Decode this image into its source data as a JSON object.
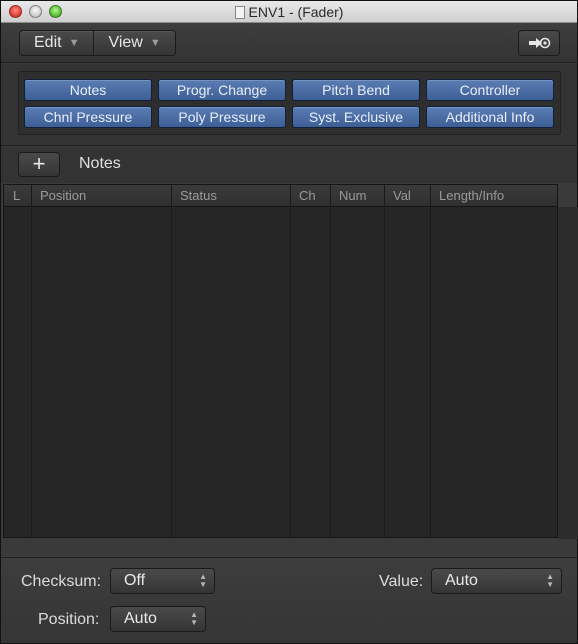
{
  "window": {
    "title": "ENV1 - (Fader)"
  },
  "toolbar": {
    "edit_label": "Edit",
    "view_label": "View",
    "link_icon": "link-arrow-icon"
  },
  "filters": [
    {
      "label": "Notes"
    },
    {
      "label": "Progr. Change"
    },
    {
      "label": "Pitch Bend"
    },
    {
      "label": "Controller"
    },
    {
      "label": "Chnl Pressure"
    },
    {
      "label": "Poly Pressure"
    },
    {
      "label": "Syst. Exclusive"
    },
    {
      "label": "Additional Info"
    }
  ],
  "notes_bar": {
    "add_label": "+",
    "title": "Notes"
  },
  "table": {
    "columns": [
      "L",
      "Position",
      "Status",
      "Ch",
      "Num",
      "Val",
      "Length/Info"
    ],
    "rows": []
  },
  "footer": {
    "checksum_label": "Checksum:",
    "checksum_value": "Off",
    "value_label": "Value:",
    "value_value": "Auto",
    "position_label": "Position:",
    "position_value": "Auto"
  },
  "colors": {
    "accent": "#4a6da5",
    "background": "#3a3a3a"
  }
}
